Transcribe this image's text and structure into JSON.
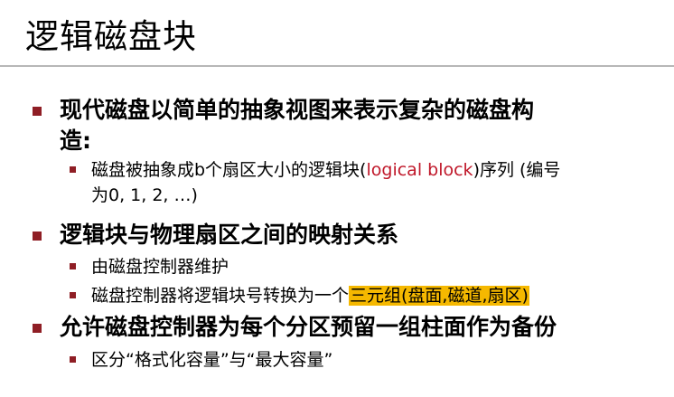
{
  "title": "逻辑磁盘块",
  "item1": {
    "line1": "现代磁盘以简单的抽象视图来表示复杂的磁盘构",
    "line2": "造:",
    "sub1": {
      "text_a": "磁盘被抽象成b个扇区大小的逻辑块(",
      "text_red": "logical block",
      "text_b": ")序列 (编号",
      "line2": "为0, 1, 2, …)"
    }
  },
  "item2": {
    "text": "逻辑块与物理扇区之间的映射关系",
    "sub1": {
      "text": "由磁盘控制器维护"
    },
    "sub2": {
      "text_a": "磁盘控制器将逻辑块号转换为一个",
      "text_highlight": "三元组(盘面,磁道,扇区)"
    }
  },
  "item3": {
    "text": "允许磁盘控制器为每个分区预留一组柱面作为备份",
    "sub1": {
      "text": "区分“格式化容量”与“最大容量”"
    }
  },
  "colors": {
    "bullet": "#8f1e25",
    "red_text": "#c0182a",
    "highlight": "#f5b800"
  }
}
